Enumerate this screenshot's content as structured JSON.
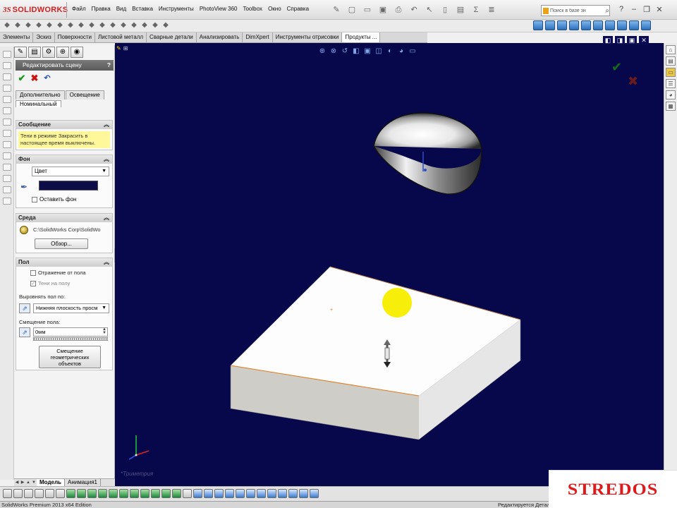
{
  "app": {
    "logo_ds": "3S",
    "logo_name": "SOLIDWORKS"
  },
  "menu": [
    "Файл",
    "Правка",
    "Вид",
    "Вставка",
    "Инструменты",
    "PhotoView 360",
    "Toolbox",
    "Окно",
    "Справка"
  ],
  "search": {
    "placeholder": "Поиск в базе зн"
  },
  "command_tabs": [
    {
      "label": "Элементы"
    },
    {
      "label": "Эскиз"
    },
    {
      "label": "Поверхности"
    },
    {
      "label": "Листовой металл"
    },
    {
      "label": "Сварные детали"
    },
    {
      "label": "Анализировать"
    },
    {
      "label": "DimXpert"
    },
    {
      "label": "Инструменты отрисовки"
    },
    {
      "label": "Продукты ..."
    }
  ],
  "property_manager": {
    "title": "Редактировать сцену",
    "help": "?",
    "tabs": [
      "Дополнительно",
      "Освещение"
    ],
    "subtab": "Номинальный",
    "message": {
      "header": "Сообщение",
      "text_line1": "Тени в режиме Закрасить в",
      "text_line2": "настоящее время выключены."
    },
    "background": {
      "header": "Фон",
      "type_value": "Цвет",
      "keep_label": "Оставить фон",
      "color": "#0d0d4a"
    },
    "environment": {
      "header": "Среда",
      "path": "C:\\SolidWorks Corp\\SolidWo",
      "browse_label": "Обзор..."
    },
    "floor": {
      "header": "Пол",
      "reflection_label": "Отражение от пола",
      "shadows_label": "Тени на полу",
      "align_label": "Выровнять пол по:",
      "align_value": "Нижняя плоскость просм",
      "offset_label": "Смещение пола:",
      "offset_value": "0мм",
      "geom_offset_line1": "Смещение",
      "geom_offset_line2": "геометрических",
      "geom_offset_line3": "объектов"
    }
  },
  "bottom_tabs": [
    "Модель",
    "Анимация1"
  ],
  "viewport": {
    "background": "#07074b",
    "view_label": "*Триметрия"
  },
  "status": {
    "left": "SolidWorks Premium 2013 x64 Edition",
    "right": "Редактируется Деталь"
  },
  "watermark": "STREDOS"
}
